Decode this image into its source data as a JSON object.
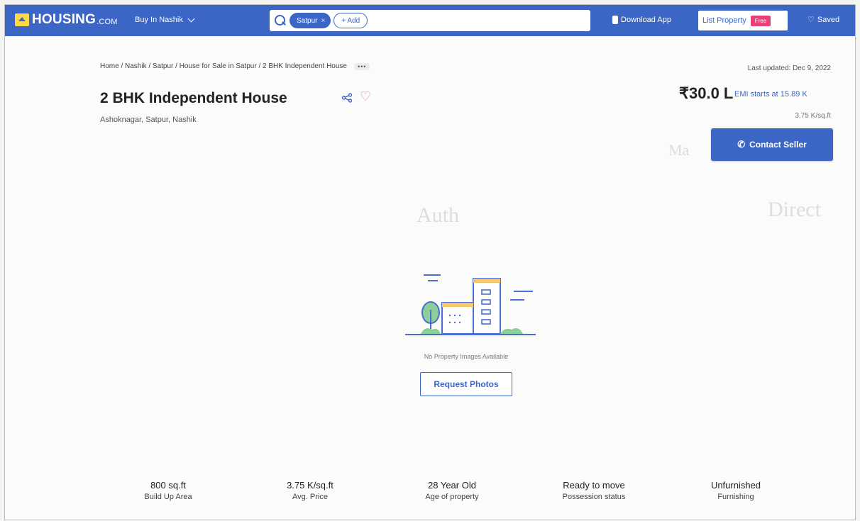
{
  "nav": {
    "logo": "HOUSING",
    "logo_suffix": ".COM",
    "buy_in": "Buy In Nashik",
    "search_chip": "Satpur",
    "add_label": "+ Add",
    "download_app": "Download App",
    "list_property": "List Property",
    "free_badge": "Free",
    "saved": "Saved"
  },
  "breadcrumb": "Home / Nashik / Satpur / House for Sale in Satpur / 2 BHK Independent House",
  "more_label": "•••",
  "last_updated": "Last updated: Dec 9, 2022",
  "title": "2 BHK Independent House",
  "locality": "Ashoknagar, Satpur, Nashik",
  "price": "₹30.0 L",
  "emi": "EMI starts at  15.89 K",
  "rate": "3.75 K/sq.ft",
  "contact_label": "Contact Seller",
  "no_images": "No Property Images Available",
  "request_photos": "Request Photos",
  "stats": [
    {
      "value": "800 sq.ft",
      "label": "Build Up Area"
    },
    {
      "value": "3.75 K/sq.ft",
      "label": "Avg. Price"
    },
    {
      "value": "28 Year Old",
      "label": "Age of property"
    },
    {
      "value": "Ready to move",
      "label": "Possession status"
    },
    {
      "value": "Unfurnished",
      "label": "Furnishing"
    }
  ]
}
